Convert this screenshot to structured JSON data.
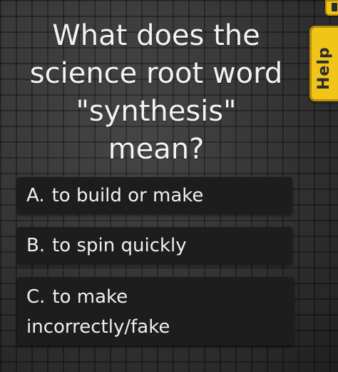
{
  "question": {
    "lines": [
      "What does the",
      "science root word",
      "\"synthesis\"",
      "mean?"
    ]
  },
  "answers": [
    {
      "letter": "A.",
      "lines": [
        "to build or make"
      ]
    },
    {
      "letter": "B.",
      "lines": [
        "to spin quickly"
      ]
    },
    {
      "letter": "C.",
      "lines": [
        "to make",
        "incorrectly/fake"
      ]
    }
  ],
  "help_tab": {
    "label": "Help"
  },
  "colors": {
    "background": "#3d3d3d",
    "answer_background": "#1d1d1d",
    "accent": "#f0c419",
    "text": "#f1f1f1"
  }
}
